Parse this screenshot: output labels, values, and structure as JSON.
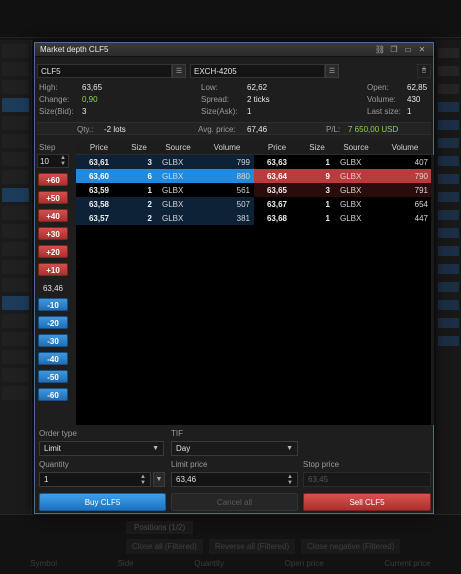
{
  "window": {
    "title": "Market depth CLF5"
  },
  "titlebar_icons": [
    "link-icon",
    "restore-icon",
    "minimize-icon",
    "close-icon"
  ],
  "symbol": {
    "value": "CLF5",
    "exchange": "EXCH-4205"
  },
  "stats": {
    "high_label": "High:",
    "high": "63,65",
    "change_label": "Change:",
    "change": "0,90",
    "sizebid_label": "Size(Bid):",
    "sizebid": "3",
    "low_label": "Low:",
    "low": "62,62",
    "spread_label": "Spread:",
    "spread": "2 ticks",
    "sizeask_label": "Size(Ask):",
    "sizeask": "1",
    "open_label": "Open:",
    "open": "62,85",
    "volume_label": "Volume:",
    "volume": "430",
    "lastsize_label": "Last size:",
    "lastsize": "1"
  },
  "position": {
    "qty_label": "Qty.:",
    "qty": "-2 lots",
    "avg_label": "Avg. price:",
    "avg": "67,46",
    "pl_label": "P/L:",
    "pl": "7 650,00 USD"
  },
  "step": {
    "label": "Step",
    "value": "10",
    "up_buttons": [
      "+60",
      "+50",
      "+40",
      "+30",
      "+20",
      "+10"
    ],
    "mid_price": "63,46",
    "down_buttons": [
      "-10",
      "-20",
      "-30",
      "-40",
      "-50",
      "-60"
    ]
  },
  "columns": {
    "price": "Price",
    "size": "Size",
    "source": "Source",
    "volume": "Volume"
  },
  "bids": [
    {
      "price": "63,61",
      "size": "3",
      "source": "GLBX",
      "volume": "799"
    },
    {
      "price": "63,60",
      "size": "6",
      "source": "GLBX",
      "volume": "880"
    },
    {
      "price": "63,59",
      "size": "1",
      "source": "GLBX",
      "volume": "561"
    },
    {
      "price": "63,58",
      "size": "2",
      "source": "GLBX",
      "volume": "507"
    },
    {
      "price": "63,57",
      "size": "2",
      "source": "GLBX",
      "volume": "381"
    }
  ],
  "asks": [
    {
      "price": "63,63",
      "size": "1",
      "source": "GLBX",
      "volume": "407"
    },
    {
      "price": "63,64",
      "size": "9",
      "source": "GLBX",
      "volume": "790"
    },
    {
      "price": "63,65",
      "size": "3",
      "source": "GLBX",
      "volume": "791"
    },
    {
      "price": "63,67",
      "size": "1",
      "source": "GLBX",
      "volume": "654"
    },
    {
      "price": "63,68",
      "size": "1",
      "source": "GLBX",
      "volume": "447"
    }
  ],
  "order": {
    "type_label": "Order type",
    "type_value": "Limit",
    "tif_label": "TIF",
    "tif_value": "Day",
    "qty_label": "Quantity",
    "qty_value": "1",
    "limit_label": "Limit price",
    "limit_value": "63,46",
    "stop_label": "Stop price",
    "stop_value": "63,45",
    "buy_label": "Buy CLF5",
    "cancel_label": "Cancel all",
    "sell_label": "Sell CLF5"
  },
  "background": {
    "tab": "Positions (1/2)",
    "buttons": [
      "Close all (Filtered)",
      "Reverse all (Filtered)",
      "Close negative (Filtered)"
    ],
    "columns": [
      "Symbol",
      "Side",
      "Quantity",
      "Open price",
      "Current price"
    ]
  },
  "colors": {
    "buy": "#1f8ae0",
    "sell": "#b83c3c",
    "green": "#8fd14f",
    "accent_border": "#4d6d8f"
  }
}
